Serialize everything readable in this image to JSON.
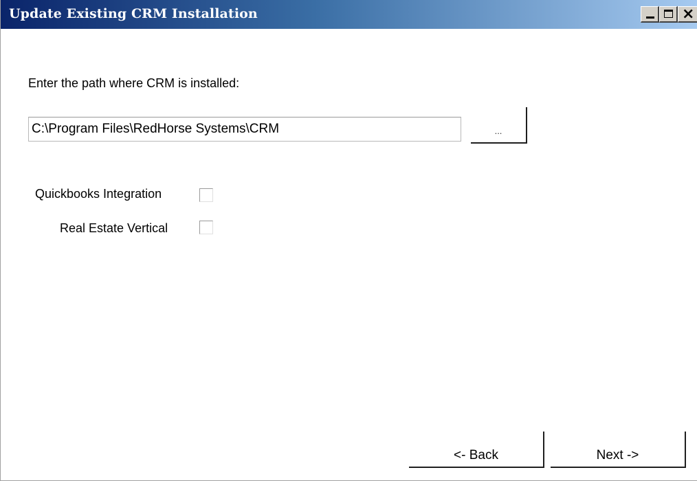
{
  "window": {
    "title": "Update Existing CRM Installation",
    "controls": {
      "minimize": "minimize",
      "maximize": "maximize",
      "close": "close"
    }
  },
  "install_path": {
    "label": "Enter the path where CRM is installed:",
    "value": "C:\\Program Files\\RedHorse Systems\\CRM",
    "browse_label": "..."
  },
  "options": {
    "quickbooks": {
      "label": "Quickbooks Integration",
      "checked": false
    },
    "real_estate": {
      "label": "Real Estate Vertical",
      "checked": false
    }
  },
  "nav": {
    "back_label": "<- Back",
    "next_label": "Next ->"
  },
  "icons": {
    "minimize": "minimize-icon",
    "maximize": "maximize-icon",
    "close": "close-icon"
  },
  "colors": {
    "titlebar_start": "#0a246a",
    "titlebar_end": "#a6caf0",
    "title_text": "#ffffff"
  }
}
